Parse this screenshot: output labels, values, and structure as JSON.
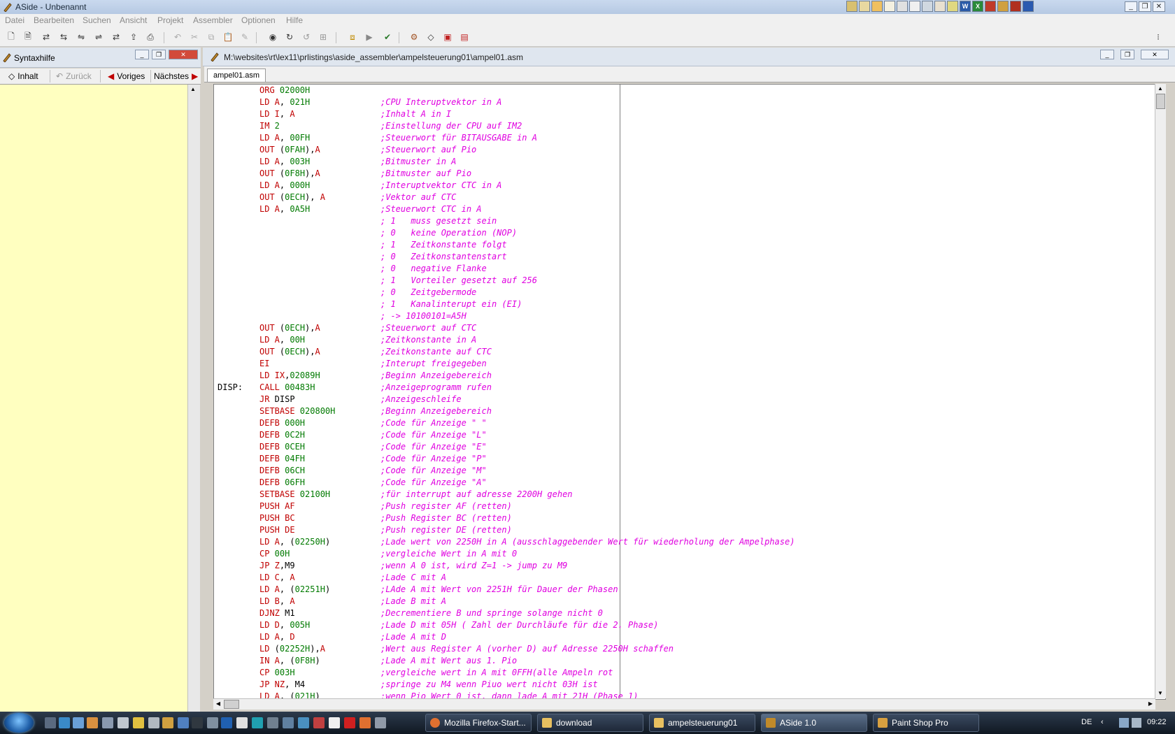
{
  "window": {
    "title": "ASide - Unbenannt"
  },
  "menu": [
    "Datei",
    "Bearbeiten",
    "Suchen",
    "Ansicht",
    "Projekt",
    "Assembler",
    "Optionen",
    "Hilfe"
  ],
  "syntax_pane": {
    "title": "Syntaxhilfe",
    "nav": {
      "contents": "Inhalt",
      "back": "Zurück",
      "previous": "Voriges",
      "next": "Nächstes"
    }
  },
  "editor": {
    "path": "M:\\websites\\rt\\lex11\\prlistings\\aside_assembler\\ampelsteuerung01\\ampel01.asm",
    "tab": "ampel01.asm",
    "lines": [
      {
        "label": "",
        "op": "ORG",
        "args": [
          {
            "t": " 02000H",
            "c": "g"
          }
        ],
        "comment": ""
      },
      {
        "label": "",
        "op": "LD",
        "args": [
          {
            "t": " A",
            "c": "r"
          },
          {
            "t": ", ",
            "c": "k"
          },
          {
            "t": "021H",
            "c": "g"
          }
        ],
        "comment": ";CPU Interuptvektor in A"
      },
      {
        "label": "",
        "op": "LD",
        "args": [
          {
            "t": " I",
            "c": "r"
          },
          {
            "t": ", ",
            "c": "k"
          },
          {
            "t": "A",
            "c": "r"
          }
        ],
        "comment": ";Inhalt A in I"
      },
      {
        "label": "",
        "op": "IM",
        "args": [
          {
            "t": " 2",
            "c": "g"
          }
        ],
        "comment": ";Einstellung der CPU auf IM2"
      },
      {
        "label": "",
        "op": "LD",
        "args": [
          {
            "t": " A",
            "c": "r"
          },
          {
            "t": ", ",
            "c": "k"
          },
          {
            "t": "00FH",
            "c": "g"
          }
        ],
        "comment": ";Steuerwort für BITAUSGABE in A"
      },
      {
        "label": "",
        "op": "OUT",
        "args": [
          {
            "t": " (",
            "c": "k"
          },
          {
            "t": "0FAH",
            "c": "g"
          },
          {
            "t": "),",
            "c": "k"
          },
          {
            "t": "A",
            "c": "r"
          }
        ],
        "comment": ";Steuerwort auf Pio"
      },
      {
        "label": "",
        "op": "LD",
        "args": [
          {
            "t": " A",
            "c": "r"
          },
          {
            "t": ", ",
            "c": "k"
          },
          {
            "t": "003H",
            "c": "g"
          }
        ],
        "comment": ";Bitmuster in A"
      },
      {
        "label": "",
        "op": "OUT",
        "args": [
          {
            "t": " (",
            "c": "k"
          },
          {
            "t": "0F8H",
            "c": "g"
          },
          {
            "t": "),",
            "c": "k"
          },
          {
            "t": "A",
            "c": "r"
          }
        ],
        "comment": ";Bitmuster auf Pio"
      },
      {
        "label": "",
        "op": "LD",
        "args": [
          {
            "t": " A",
            "c": "r"
          },
          {
            "t": ", ",
            "c": "k"
          },
          {
            "t": "000H",
            "c": "g"
          }
        ],
        "comment": ";Interuptvektor CTC in A"
      },
      {
        "label": "",
        "op": "OUT",
        "args": [
          {
            "t": " (",
            "c": "k"
          },
          {
            "t": "0ECH",
            "c": "g"
          },
          {
            "t": "), ",
            "c": "k"
          },
          {
            "t": "A",
            "c": "r"
          }
        ],
        "comment": ";Vektor auf CTC"
      },
      {
        "label": "",
        "op": "LD",
        "args": [
          {
            "t": " A",
            "c": "r"
          },
          {
            "t": ", ",
            "c": "k"
          },
          {
            "t": "0A5H",
            "c": "g"
          }
        ],
        "comment": ";Steuerwort CTC in A"
      },
      {
        "label": "",
        "op": "",
        "args": [],
        "comment": "; 1   muss gesetzt sein"
      },
      {
        "label": "",
        "op": "",
        "args": [],
        "comment": "; 0   keine Operation (NOP)"
      },
      {
        "label": "",
        "op": "",
        "args": [],
        "comment": "; 1   Zeitkonstante folgt"
      },
      {
        "label": "",
        "op": "",
        "args": [],
        "comment": "; 0   Zeitkonstantenstart"
      },
      {
        "label": "",
        "op": "",
        "args": [],
        "comment": "; 0   negative Flanke"
      },
      {
        "label": "",
        "op": "",
        "args": [],
        "comment": "; 1   Vorteiler gesetzt auf 256"
      },
      {
        "label": "",
        "op": "",
        "args": [],
        "comment": "; 0   Zeitgebermode"
      },
      {
        "label": "",
        "op": "",
        "args": [],
        "comment": "; 1   Kanalinterupt ein (EI)"
      },
      {
        "label": "",
        "op": "",
        "args": [],
        "comment": "; -> 10100101=A5H"
      },
      {
        "label": "",
        "op": "OUT",
        "args": [
          {
            "t": " (",
            "c": "k"
          },
          {
            "t": "0ECH",
            "c": "g"
          },
          {
            "t": "),",
            "c": "k"
          },
          {
            "t": "A",
            "c": "r"
          }
        ],
        "comment": ";Steuerwort auf CTC"
      },
      {
        "label": "",
        "op": "LD",
        "args": [
          {
            "t": " A",
            "c": "r"
          },
          {
            "t": ", ",
            "c": "k"
          },
          {
            "t": "00H",
            "c": "g"
          }
        ],
        "comment": ";Zeitkonstante in A"
      },
      {
        "label": "",
        "op": "OUT",
        "args": [
          {
            "t": " (",
            "c": "k"
          },
          {
            "t": "0ECH",
            "c": "g"
          },
          {
            "t": "),",
            "c": "k"
          },
          {
            "t": "A",
            "c": "r"
          }
        ],
        "comment": ";Zeitkonstante auf CTC"
      },
      {
        "label": "",
        "op": "EI",
        "args": [],
        "comment": ";Interupt freigegeben"
      },
      {
        "label": "",
        "op": "LD",
        "args": [
          {
            "t": " IX",
            "c": "r"
          },
          {
            "t": ",",
            "c": "k"
          },
          {
            "t": "02089H",
            "c": "g"
          }
        ],
        "comment": ";Beginn Anzeigebereich"
      },
      {
        "label": "DISP:",
        "op": "CALL",
        "args": [
          {
            "t": " 00483H",
            "c": "g"
          }
        ],
        "comment": ";Anzeigeprogramm rufen"
      },
      {
        "label": "",
        "op": "JR",
        "args": [
          {
            "t": " DISP",
            "c": "k"
          }
        ],
        "comment": ";Anzeigeschleife"
      },
      {
        "label": "",
        "op": "SETBASE",
        "args": [
          {
            "t": " 020800H",
            "c": "g"
          }
        ],
        "comment": ";Beginn Anzeigebereich"
      },
      {
        "label": "",
        "op": "DEFB",
        "args": [
          {
            "t": " 000H",
            "c": "g"
          }
        ],
        "comment": ";Code für Anzeige \" \""
      },
      {
        "label": "",
        "op": "DEFB",
        "args": [
          {
            "t": " 0C2H",
            "c": "g"
          }
        ],
        "comment": ";Code für Anzeige \"L\""
      },
      {
        "label": "",
        "op": "DEFB",
        "args": [
          {
            "t": " 0CEH",
            "c": "g"
          }
        ],
        "comment": ";Code für Anzeige \"E\""
      },
      {
        "label": "",
        "op": "DEFB",
        "args": [
          {
            "t": " 04FH",
            "c": "g"
          }
        ],
        "comment": ";Code für Anzeige \"P\""
      },
      {
        "label": "",
        "op": "DEFB",
        "args": [
          {
            "t": " 06CH",
            "c": "g"
          }
        ],
        "comment": ";Code für Anzeige \"M\""
      },
      {
        "label": "",
        "op": "DEFB",
        "args": [
          {
            "t": " 06FH",
            "c": "g"
          }
        ],
        "comment": ";Code für Anzeige \"A\""
      },
      {
        "label": "",
        "op": "SETBASE",
        "args": [
          {
            "t": " 02100H",
            "c": "g"
          }
        ],
        "comment": ";für interrupt auf adresse 2200H gehen"
      },
      {
        "label": "",
        "op": "PUSH",
        "args": [
          {
            "t": " AF",
            "c": "r"
          }
        ],
        "comment": ";Push register AF (retten)"
      },
      {
        "label": "",
        "op": "PUSH",
        "args": [
          {
            "t": " BC",
            "c": "r"
          }
        ],
        "comment": ";Push Register BC (retten)"
      },
      {
        "label": "",
        "op": "PUSH",
        "args": [
          {
            "t": " DE",
            "c": "r"
          }
        ],
        "comment": ";Push register DE (retten)"
      },
      {
        "label": "",
        "op": "LD",
        "args": [
          {
            "t": " A",
            "c": "r"
          },
          {
            "t": ", (",
            "c": "k"
          },
          {
            "t": "02250H",
            "c": "g"
          },
          {
            "t": ")",
            "c": "k"
          }
        ],
        "comment": ";Lade wert von 2250H in A (ausschlaggebender Wert für wiederholung der Ampelphase)"
      },
      {
        "label": "",
        "op": "CP",
        "args": [
          {
            "t": " 00H",
            "c": "g"
          }
        ],
        "comment": ";vergleiche Wert in A mit 0"
      },
      {
        "label": "",
        "op": "JP",
        "args": [
          {
            "t": " Z",
            "c": "r"
          },
          {
            "t": ",M9",
            "c": "k"
          }
        ],
        "comment": ";wenn A 0 ist, wird Z=1 -> jump zu M9"
      },
      {
        "label": "",
        "op": "LD",
        "args": [
          {
            "t": " C",
            "c": "r"
          },
          {
            "t": ", ",
            "c": "k"
          },
          {
            "t": "A",
            "c": "r"
          }
        ],
        "comment": ";Lade C mit A"
      },
      {
        "label": "",
        "op": "LD",
        "args": [
          {
            "t": " A",
            "c": "r"
          },
          {
            "t": ", (",
            "c": "k"
          },
          {
            "t": "02251H",
            "c": "g"
          },
          {
            "t": ")",
            "c": "k"
          }
        ],
        "comment": ";LAde A mit Wert von 2251H für Dauer der Phasen"
      },
      {
        "label": "",
        "op": "LD",
        "args": [
          {
            "t": " B",
            "c": "r"
          },
          {
            "t": ", ",
            "c": "k"
          },
          {
            "t": "A",
            "c": "r"
          }
        ],
        "comment": ";Lade B mit A"
      },
      {
        "label": "",
        "op": "DJNZ",
        "args": [
          {
            "t": " M1",
            "c": "k"
          }
        ],
        "comment": ";Decrementiere B und springe solange nicht 0"
      },
      {
        "label": "",
        "op": "LD",
        "args": [
          {
            "t": " D",
            "c": "r"
          },
          {
            "t": ", ",
            "c": "k"
          },
          {
            "t": "005H",
            "c": "g"
          }
        ],
        "comment": ";Lade D mit 05H ( Zahl der Durchläufe für die 2. Phase)"
      },
      {
        "label": "",
        "op": "LD",
        "args": [
          {
            "t": " A",
            "c": "r"
          },
          {
            "t": ", ",
            "c": "k"
          },
          {
            "t": "D",
            "c": "r"
          }
        ],
        "comment": ";Lade A mit D"
      },
      {
        "label": "",
        "op": "LD",
        "args": [
          {
            "t": " (",
            "c": "k"
          },
          {
            "t": "02252H",
            "c": "g"
          },
          {
            "t": "),",
            "c": "k"
          },
          {
            "t": "A",
            "c": "r"
          }
        ],
        "comment": ";Wert aus Register A (vorher D) auf Adresse 2250H schaffen"
      },
      {
        "label": "",
        "op": "IN",
        "args": [
          {
            "t": " A",
            "c": "r"
          },
          {
            "t": ", (",
            "c": "k"
          },
          {
            "t": "0F8H",
            "c": "g"
          },
          {
            "t": ")",
            "c": "k"
          }
        ],
        "comment": ";Lade A mit Wert aus 1. Pio"
      },
      {
        "label": "",
        "op": "CP",
        "args": [
          {
            "t": " 003H",
            "c": "g"
          }
        ],
        "comment": ";vergleiche wert in A mit 0FFH(alle Ampeln rot"
      },
      {
        "label": "",
        "op": "JP",
        "args": [
          {
            "t": " NZ",
            "c": "r"
          },
          {
            "t": ", M4",
            "c": "k"
          }
        ],
        "comment": ";springe zu M4 wenn Piuo wert nicht 03H ist"
      },
      {
        "label": "",
        "op": "LD",
        "args": [
          {
            "t": " A",
            "c": "r"
          },
          {
            "t": ", (",
            "c": "k"
          },
          {
            "t": "021H",
            "c": "g"
          },
          {
            "t": ")",
            "c": "k"
          }
        ],
        "comment": ";wenn Pio Wert 0 ist, dann lade A mit 21H (Phase 1)"
      }
    ]
  },
  "taskbar": {
    "buttons": [
      "Mozilla Firefox-Start...",
      "download",
      "ampelsteuerung01",
      "ASide 1.0",
      "Paint Shop Pro"
    ],
    "lang": "DE",
    "clock": "09:22"
  },
  "colors": {
    "accent": "#1f5fa8",
    "syntax_bg": "#ffffc0",
    "opcode": "#c00000",
    "number": "#007a00",
    "comment": "#e000e0"
  }
}
